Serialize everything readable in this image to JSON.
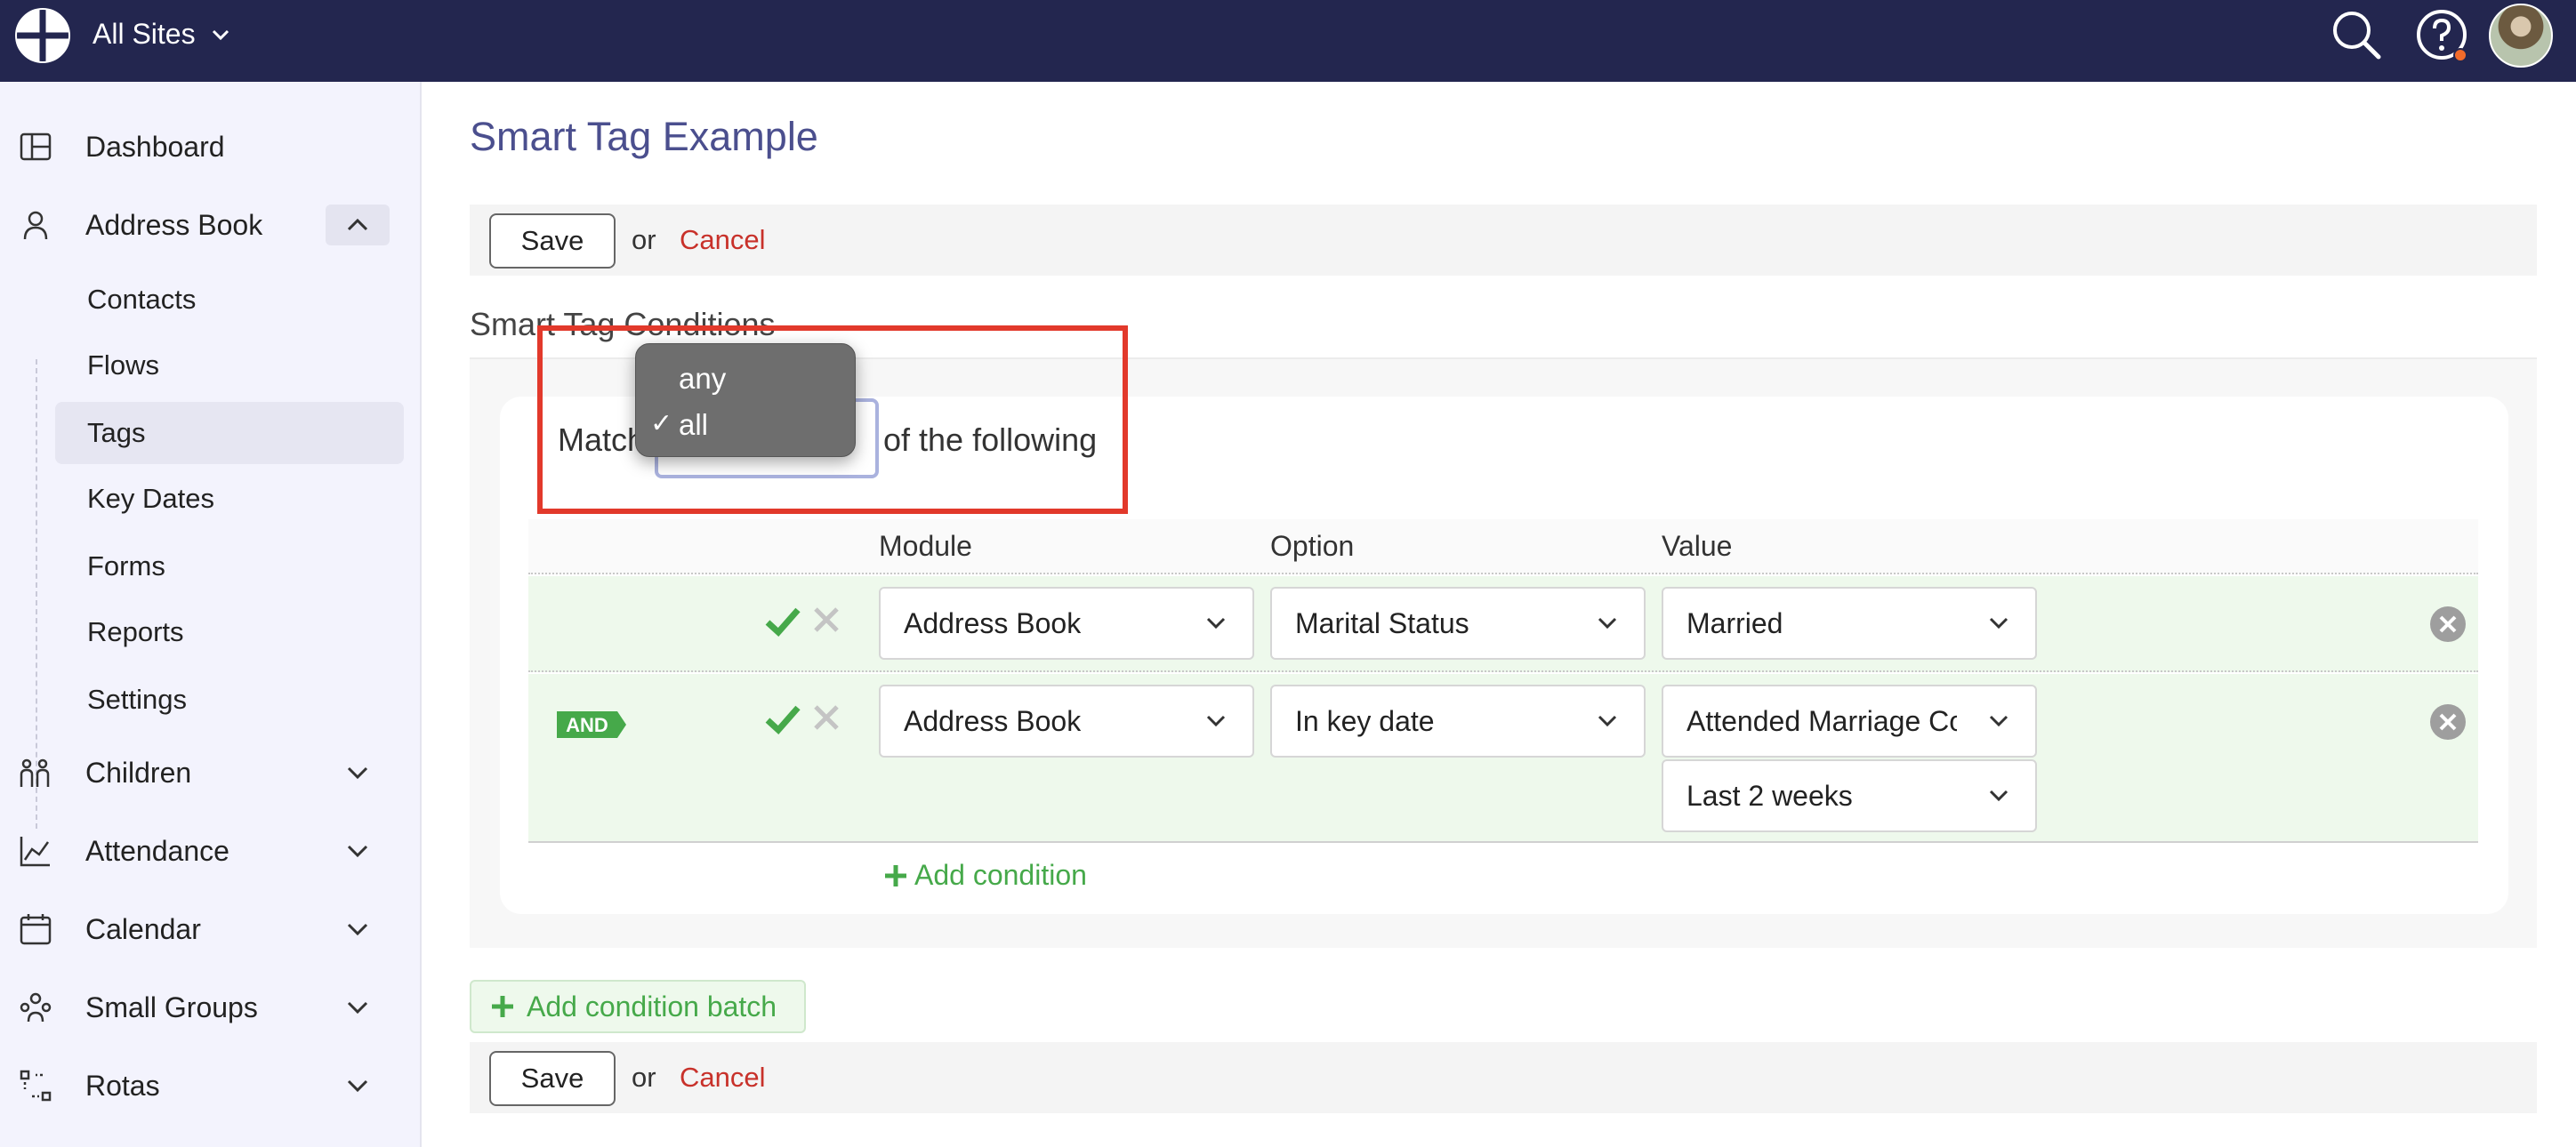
{
  "topbar": {
    "site_selector": "All Sites",
    "icons": [
      "logo-icon",
      "search-icon",
      "help-icon",
      "avatar"
    ]
  },
  "sidebar": {
    "items": [
      {
        "label": "Dashboard",
        "icon": "dashboard-icon"
      },
      {
        "label": "Address Book",
        "icon": "person-icon",
        "expanded": true
      },
      {
        "label": "Children",
        "icon": "children-icon"
      },
      {
        "label": "Attendance",
        "icon": "chart-icon"
      },
      {
        "label": "Calendar",
        "icon": "calendar-icon"
      },
      {
        "label": "Small Groups",
        "icon": "groups-icon"
      },
      {
        "label": "Rotas",
        "icon": "rotas-icon"
      }
    ],
    "subitems": [
      "Contacts",
      "Flows",
      "Tags",
      "Key Dates",
      "Forms",
      "Reports",
      "Settings"
    ],
    "active_subitem": "Tags"
  },
  "page": {
    "title": "Smart Tag Example",
    "save_label": "Save",
    "or_label": "or",
    "cancel_label": "Cancel",
    "section_title": "Smart Tag Conditions"
  },
  "match": {
    "prefix": "Match",
    "suffix": "of the following",
    "options": [
      "any",
      "all"
    ],
    "selected": "all"
  },
  "table": {
    "headers": {
      "module": "Module",
      "option": "Option",
      "value": "Value"
    },
    "rows": [
      {
        "module": "Address Book",
        "option": "Marital Status",
        "value": "Married"
      },
      {
        "connector": "AND",
        "module": "Address Book",
        "option": "In key date",
        "value": "Attended Marriage Course",
        "value2": "Last 2 weeks"
      }
    ]
  },
  "actions": {
    "add_condition": "Add condition",
    "add_condition_batch": "Add condition batch"
  },
  "colors": {
    "topbar": "#23264f",
    "title": "#4b4f8e",
    "cancel": "#c8312a",
    "green": "#46a94a",
    "highlight": "#e2392b"
  }
}
